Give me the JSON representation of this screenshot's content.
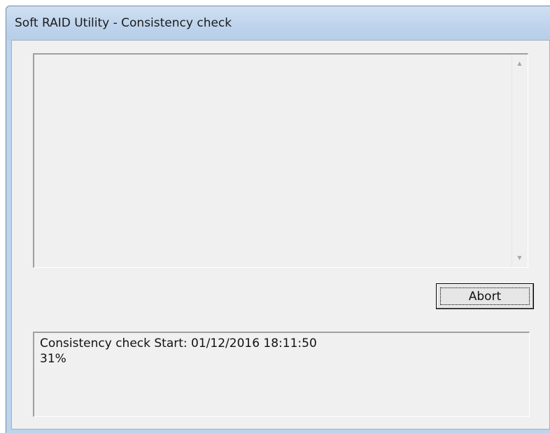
{
  "window": {
    "title": "Soft RAID Utility - Consistency check"
  },
  "top_list": {
    "items": [],
    "scroll_up_icon": "▲",
    "scroll_down_icon": "▼"
  },
  "actions": {
    "abort_label": "Abort"
  },
  "status": {
    "line1": "Consistency check Start: 01/12/2016 18:11:50",
    "progress_text": "31%"
  }
}
